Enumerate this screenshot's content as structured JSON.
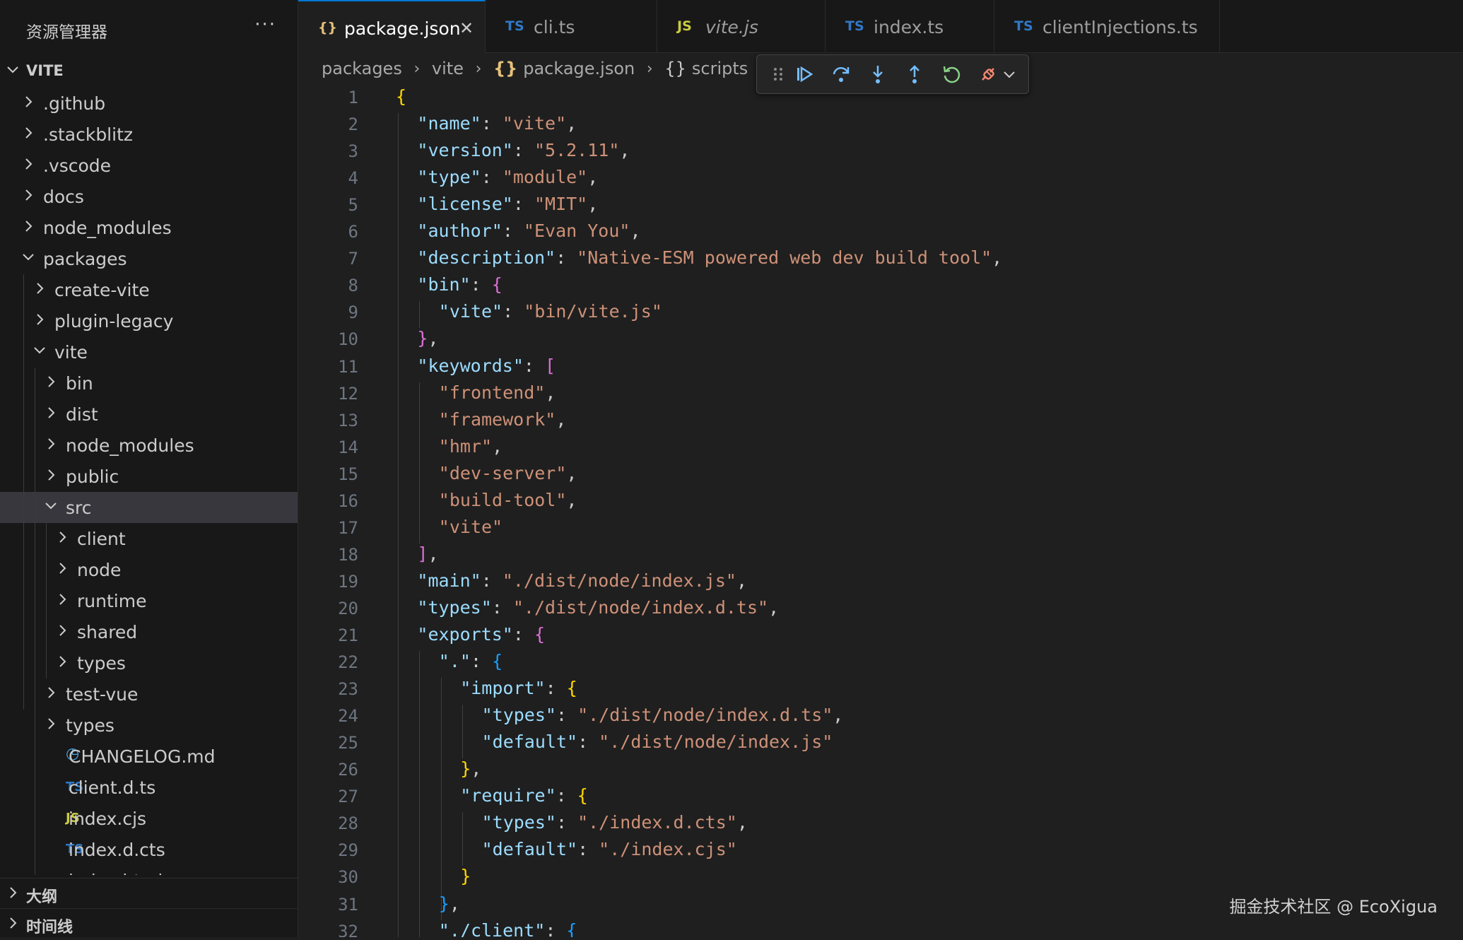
{
  "sidebar": {
    "title": "资源管理器",
    "more": "···",
    "root": "VITE",
    "items": [
      {
        "label": ".github",
        "kind": "folder",
        "depth": 0,
        "open": false
      },
      {
        "label": ".stackblitz",
        "kind": "folder",
        "depth": 0,
        "open": false
      },
      {
        "label": ".vscode",
        "kind": "folder",
        "depth": 0,
        "open": false
      },
      {
        "label": "docs",
        "kind": "folder",
        "depth": 0,
        "open": false
      },
      {
        "label": "node_modules",
        "kind": "folder",
        "depth": 0,
        "open": false
      },
      {
        "label": "packages",
        "kind": "folder",
        "depth": 0,
        "open": true
      },
      {
        "label": "create-vite",
        "kind": "folder",
        "depth": 1,
        "open": false
      },
      {
        "label": "plugin-legacy",
        "kind": "folder",
        "depth": 1,
        "open": false
      },
      {
        "label": "vite",
        "kind": "folder",
        "depth": 1,
        "open": true
      },
      {
        "label": "bin",
        "kind": "folder",
        "depth": 2,
        "open": false
      },
      {
        "label": "dist",
        "kind": "folder",
        "depth": 2,
        "open": false
      },
      {
        "label": "node_modules",
        "kind": "folder",
        "depth": 2,
        "open": false
      },
      {
        "label": "public",
        "kind": "folder",
        "depth": 2,
        "open": false
      },
      {
        "label": "src",
        "kind": "folder",
        "depth": 2,
        "open": true,
        "selected": true
      },
      {
        "label": "client",
        "kind": "folder",
        "depth": 3,
        "open": false
      },
      {
        "label": "node",
        "kind": "folder",
        "depth": 3,
        "open": false
      },
      {
        "label": "runtime",
        "kind": "folder",
        "depth": 3,
        "open": false
      },
      {
        "label": "shared",
        "kind": "folder",
        "depth": 3,
        "open": false
      },
      {
        "label": "types",
        "kind": "folder",
        "depth": 3,
        "open": false
      },
      {
        "label": "test-vue",
        "kind": "folder",
        "depth": 2,
        "open": false
      },
      {
        "label": "types",
        "kind": "folder",
        "depth": 2,
        "open": false
      },
      {
        "label": "CHANGELOG.md",
        "kind": "file",
        "icon": "clock-icon",
        "badge": "◷",
        "depth": 2
      },
      {
        "label": "client.d.ts",
        "kind": "file",
        "icon": "ts-icon",
        "badge": "TS",
        "depth": 2
      },
      {
        "label": "index.cjs",
        "kind": "file",
        "icon": "js-icon",
        "badge": "JS",
        "depth": 2
      },
      {
        "label": "index.d.cts",
        "kind": "file",
        "icon": "ts-icon",
        "badge": "TS",
        "depth": 2
      },
      {
        "label": "index.html",
        "kind": "file",
        "icon": "html-icon",
        "badge": "<>",
        "depth": 2
      }
    ],
    "outline": "大纲",
    "timeline": "时间线"
  },
  "tabs": [
    {
      "icon": "json-icon",
      "badge": "{}",
      "label": "package.json",
      "active": true,
      "close": "✕"
    },
    {
      "icon": "ts-icon",
      "badge": "TS",
      "label": "cli.ts",
      "active": false
    },
    {
      "icon": "js-icon",
      "badge": "JS",
      "label": "vite.js",
      "active": false,
      "italic": true
    },
    {
      "icon": "ts-icon",
      "badge": "TS",
      "label": "index.ts",
      "active": false
    },
    {
      "icon": "ts-icon",
      "badge": "TS",
      "label": "clientInjections.ts",
      "active": false
    }
  ],
  "breadcrumb": [
    "packages",
    "vite",
    "package.json",
    "scripts"
  ],
  "breadcrumb_braces": "{}",
  "debug_toolbar": [
    "drag-handle",
    "continue",
    "step-over",
    "step-into",
    "step-out",
    "restart",
    "disconnect"
  ],
  "colors": {
    "accent": "#0078d4",
    "json_badge": "#e5c07b",
    "ts_badge": "#3178c6",
    "js_badge": "#cbcb41",
    "key": "#9cdcfe",
    "string": "#ce9178",
    "bracket_gold": "#ffd700",
    "bracket_purple": "#da70d6",
    "bracket_blue": "#179fff"
  },
  "code": [
    {
      "n": "1",
      "indent": 0,
      "t": [
        [
          "b1",
          "{"
        ]
      ]
    },
    {
      "n": "2",
      "indent": 1,
      "t": [
        [
          "k",
          "\"name\""
        ],
        [
          "p",
          ": "
        ],
        [
          "s",
          "\"vite\""
        ],
        [
          "p",
          ","
        ]
      ]
    },
    {
      "n": "3",
      "indent": 1,
      "t": [
        [
          "k",
          "\"version\""
        ],
        [
          "p",
          ": "
        ],
        [
          "s",
          "\"5.2.11\""
        ],
        [
          "p",
          ","
        ]
      ]
    },
    {
      "n": "4",
      "indent": 1,
      "t": [
        [
          "k",
          "\"type\""
        ],
        [
          "p",
          ": "
        ],
        [
          "s",
          "\"module\""
        ],
        [
          "p",
          ","
        ]
      ]
    },
    {
      "n": "5",
      "indent": 1,
      "t": [
        [
          "k",
          "\"license\""
        ],
        [
          "p",
          ": "
        ],
        [
          "s",
          "\"MIT\""
        ],
        [
          "p",
          ","
        ]
      ]
    },
    {
      "n": "6",
      "indent": 1,
      "t": [
        [
          "k",
          "\"author\""
        ],
        [
          "p",
          ": "
        ],
        [
          "s",
          "\"Evan You\""
        ],
        [
          "p",
          ","
        ]
      ]
    },
    {
      "n": "7",
      "indent": 1,
      "t": [
        [
          "k",
          "\"description\""
        ],
        [
          "p",
          ": "
        ],
        [
          "s",
          "\"Native-ESM powered web dev build tool\""
        ],
        [
          "p",
          ","
        ]
      ]
    },
    {
      "n": "8",
      "indent": 1,
      "t": [
        [
          "k",
          "\"bin\""
        ],
        [
          "p",
          ": "
        ],
        [
          "b2",
          "{"
        ]
      ]
    },
    {
      "n": "9",
      "indent": 2,
      "t": [
        [
          "k",
          "\"vite\""
        ],
        [
          "p",
          ": "
        ],
        [
          "s",
          "\"bin/vite.js\""
        ]
      ]
    },
    {
      "n": "10",
      "indent": 1,
      "t": [
        [
          "b2",
          "}"
        ],
        [
          "p",
          ","
        ]
      ]
    },
    {
      "n": "11",
      "indent": 1,
      "t": [
        [
          "k",
          "\"keywords\""
        ],
        [
          "p",
          ": "
        ],
        [
          "b2",
          "["
        ]
      ]
    },
    {
      "n": "12",
      "indent": 2,
      "t": [
        [
          "s",
          "\"frontend\""
        ],
        [
          "p",
          ","
        ]
      ]
    },
    {
      "n": "13",
      "indent": 2,
      "t": [
        [
          "s",
          "\"framework\""
        ],
        [
          "p",
          ","
        ]
      ]
    },
    {
      "n": "14",
      "indent": 2,
      "t": [
        [
          "s",
          "\"hmr\""
        ],
        [
          "p",
          ","
        ]
      ]
    },
    {
      "n": "15",
      "indent": 2,
      "t": [
        [
          "s",
          "\"dev-server\""
        ],
        [
          "p",
          ","
        ]
      ]
    },
    {
      "n": "16",
      "indent": 2,
      "t": [
        [
          "s",
          "\"build-tool\""
        ],
        [
          "p",
          ","
        ]
      ]
    },
    {
      "n": "17",
      "indent": 2,
      "t": [
        [
          "s",
          "\"vite\""
        ]
      ]
    },
    {
      "n": "18",
      "indent": 1,
      "t": [
        [
          "b2",
          "]"
        ],
        [
          "p",
          ","
        ]
      ]
    },
    {
      "n": "19",
      "indent": 1,
      "t": [
        [
          "k",
          "\"main\""
        ],
        [
          "p",
          ": "
        ],
        [
          "s",
          "\"./dist/node/index.js\""
        ],
        [
          "p",
          ","
        ]
      ]
    },
    {
      "n": "20",
      "indent": 1,
      "t": [
        [
          "k",
          "\"types\""
        ],
        [
          "p",
          ": "
        ],
        [
          "s",
          "\"./dist/node/index.d.ts\""
        ],
        [
          "p",
          ","
        ]
      ]
    },
    {
      "n": "21",
      "indent": 1,
      "t": [
        [
          "k",
          "\"exports\""
        ],
        [
          "p",
          ": "
        ],
        [
          "b2",
          "{"
        ]
      ]
    },
    {
      "n": "22",
      "indent": 2,
      "t": [
        [
          "k",
          "\".\""
        ],
        [
          "p",
          ": "
        ],
        [
          "b3",
          "{"
        ]
      ]
    },
    {
      "n": "23",
      "indent": 3,
      "t": [
        [
          "k",
          "\"import\""
        ],
        [
          "p",
          ": "
        ],
        [
          "b1",
          "{"
        ]
      ]
    },
    {
      "n": "24",
      "indent": 4,
      "t": [
        [
          "k",
          "\"types\""
        ],
        [
          "p",
          ": "
        ],
        [
          "s",
          "\"./dist/node/index.d.ts\""
        ],
        [
          "p",
          ","
        ]
      ]
    },
    {
      "n": "25",
      "indent": 4,
      "t": [
        [
          "k",
          "\"default\""
        ],
        [
          "p",
          ": "
        ],
        [
          "s",
          "\"./dist/node/index.js\""
        ]
      ]
    },
    {
      "n": "26",
      "indent": 3,
      "t": [
        [
          "b1",
          "}"
        ],
        [
          "p",
          ","
        ]
      ]
    },
    {
      "n": "27",
      "indent": 3,
      "t": [
        [
          "k",
          "\"require\""
        ],
        [
          "p",
          ": "
        ],
        [
          "b1",
          "{"
        ]
      ]
    },
    {
      "n": "28",
      "indent": 4,
      "t": [
        [
          "k",
          "\"types\""
        ],
        [
          "p",
          ": "
        ],
        [
          "s",
          "\"./index.d.cts\""
        ],
        [
          "p",
          ","
        ]
      ]
    },
    {
      "n": "29",
      "indent": 4,
      "t": [
        [
          "k",
          "\"default\""
        ],
        [
          "p",
          ": "
        ],
        [
          "s",
          "\"./index.cjs\""
        ]
      ]
    },
    {
      "n": "30",
      "indent": 3,
      "t": [
        [
          "b1",
          "}"
        ]
      ]
    },
    {
      "n": "31",
      "indent": 2,
      "t": [
        [
          "b3",
          "}"
        ],
        [
          "p",
          ","
        ]
      ]
    },
    {
      "n": "32",
      "indent": 2,
      "t": [
        [
          "k",
          "\"./client\""
        ],
        [
          "p",
          ": "
        ],
        [
          "b3",
          "{"
        ]
      ]
    }
  ],
  "watermark": "掘金技术社区 @ EcoXigua"
}
